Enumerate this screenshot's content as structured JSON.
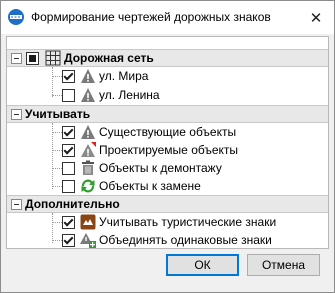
{
  "window": {
    "title": "Формирование чертежей дорожных знаков",
    "close_glyph": "✕",
    "accent_color": "#0078d7"
  },
  "tree": {
    "road_network": {
      "expander": "−",
      "label": "Дорожная сеть",
      "state": "partial",
      "icon": "road-network-icon",
      "items": [
        {
          "label": "ул. Мира",
          "checked": true,
          "icon": "road-sign-icon"
        },
        {
          "label": "ул. Ленина",
          "checked": false,
          "icon": "road-sign-icon"
        }
      ]
    },
    "consider": {
      "expander": "−",
      "label": "Учитывать",
      "items": [
        {
          "label": "Существующие объекты",
          "checked": true,
          "icon": "road-sign-icon"
        },
        {
          "label": "Проектируемые объекты",
          "checked": true,
          "icon": "projected-sign-icon"
        },
        {
          "label": "Объекты к демонтажу",
          "checked": false,
          "icon": "trash-icon"
        },
        {
          "label": "Объекты к замене",
          "checked": false,
          "icon": "replace-icon"
        }
      ]
    },
    "additional": {
      "expander": "−",
      "label": "Дополнительно",
      "items": [
        {
          "label": "Учитывать туристические знаки",
          "checked": true,
          "icon": "tourist-sign-icon"
        },
        {
          "label": "Объединять одинаковые знаки",
          "checked": true,
          "icon": "merge-signs-icon"
        }
      ]
    }
  },
  "buttons": {
    "ok": "ОК",
    "cancel": "Отмена"
  }
}
